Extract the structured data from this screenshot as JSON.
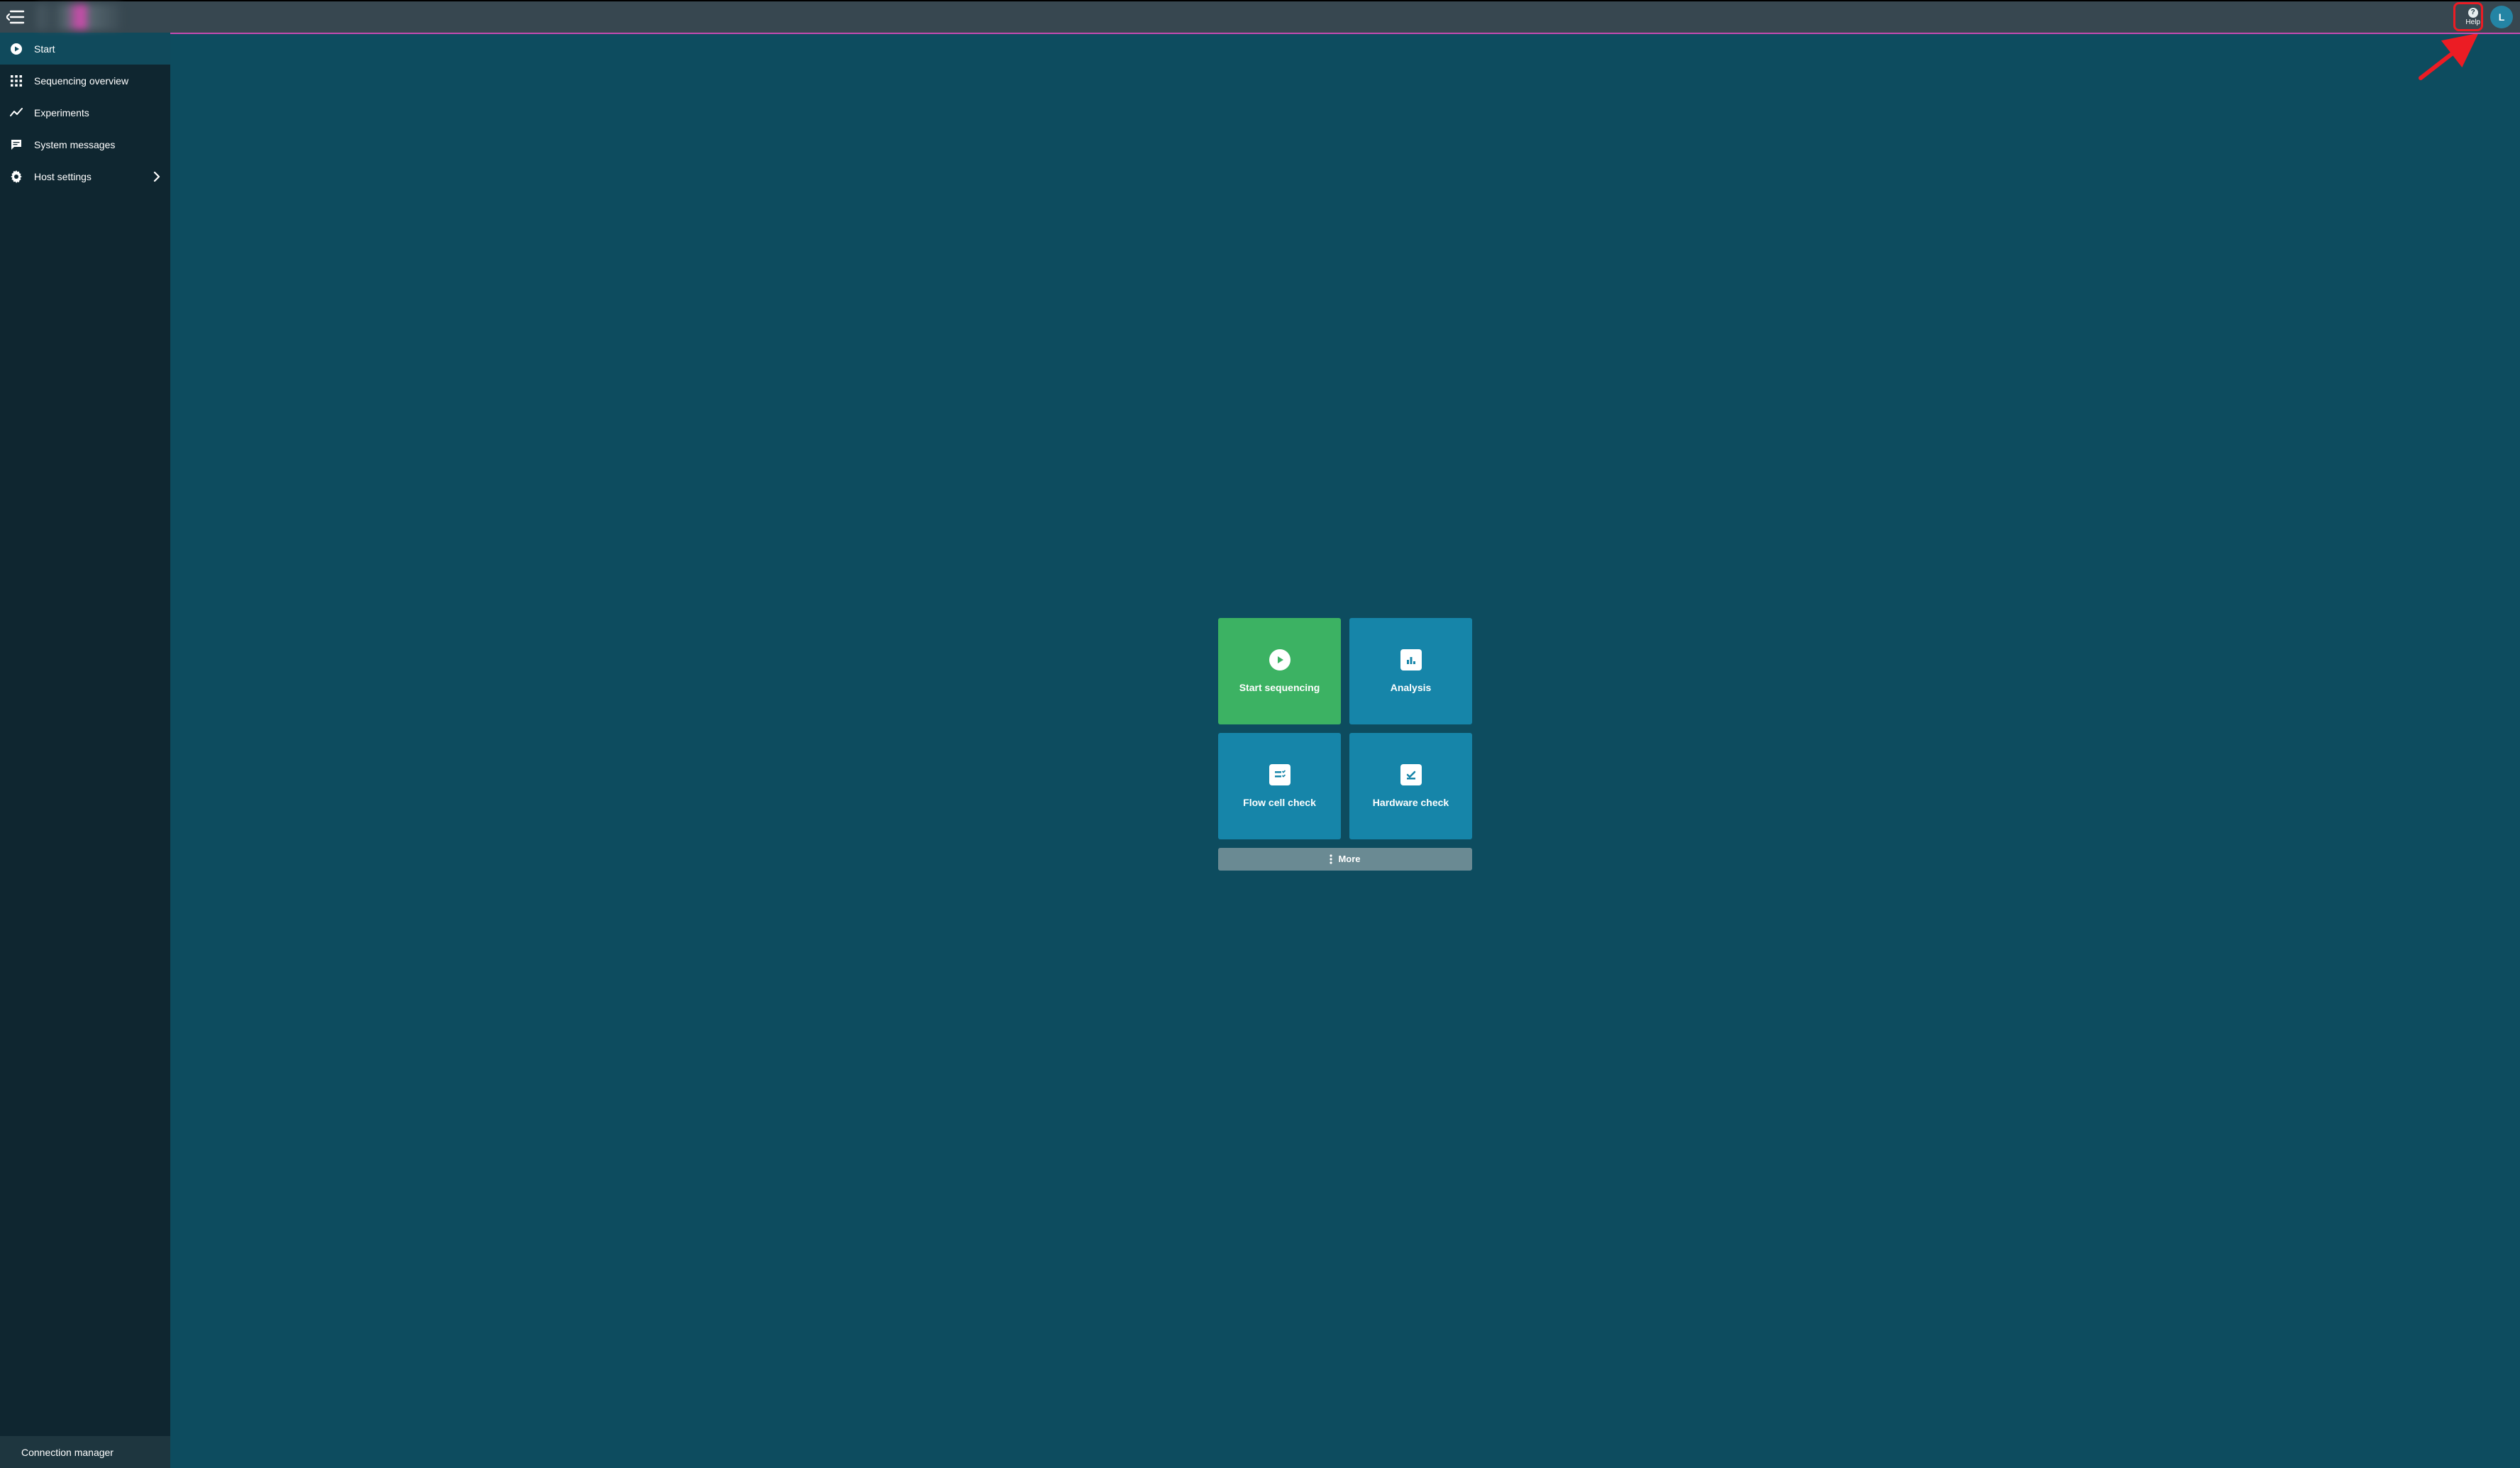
{
  "header": {
    "help_label": "Help",
    "avatar_initial": "L"
  },
  "sidebar": {
    "items": [
      {
        "label": "Start",
        "icon": "play-circle-icon",
        "active": true,
        "has_chevron": false
      },
      {
        "label": "Sequencing overview",
        "icon": "apps-grid-icon",
        "active": false,
        "has_chevron": false
      },
      {
        "label": "Experiments",
        "icon": "trend-line-icon",
        "active": false,
        "has_chevron": false
      },
      {
        "label": "System messages",
        "icon": "message-icon",
        "active": false,
        "has_chevron": false
      },
      {
        "label": "Host settings",
        "icon": "gear-icon",
        "active": false,
        "has_chevron": true
      }
    ],
    "footer": {
      "label": "Connection manager",
      "icon": "hub-icon"
    }
  },
  "main": {
    "tiles": [
      {
        "label": "Start sequencing",
        "icon": "play-icon",
        "color": "green"
      },
      {
        "label": "Analysis",
        "icon": "bar-chart-icon",
        "color": "teal"
      },
      {
        "label": "Flow cell check",
        "icon": "checklist-icon",
        "color": "teal"
      },
      {
        "label": "Hardware check",
        "icon": "check-box-icon",
        "color": "teal"
      }
    ],
    "more_label": "More"
  }
}
